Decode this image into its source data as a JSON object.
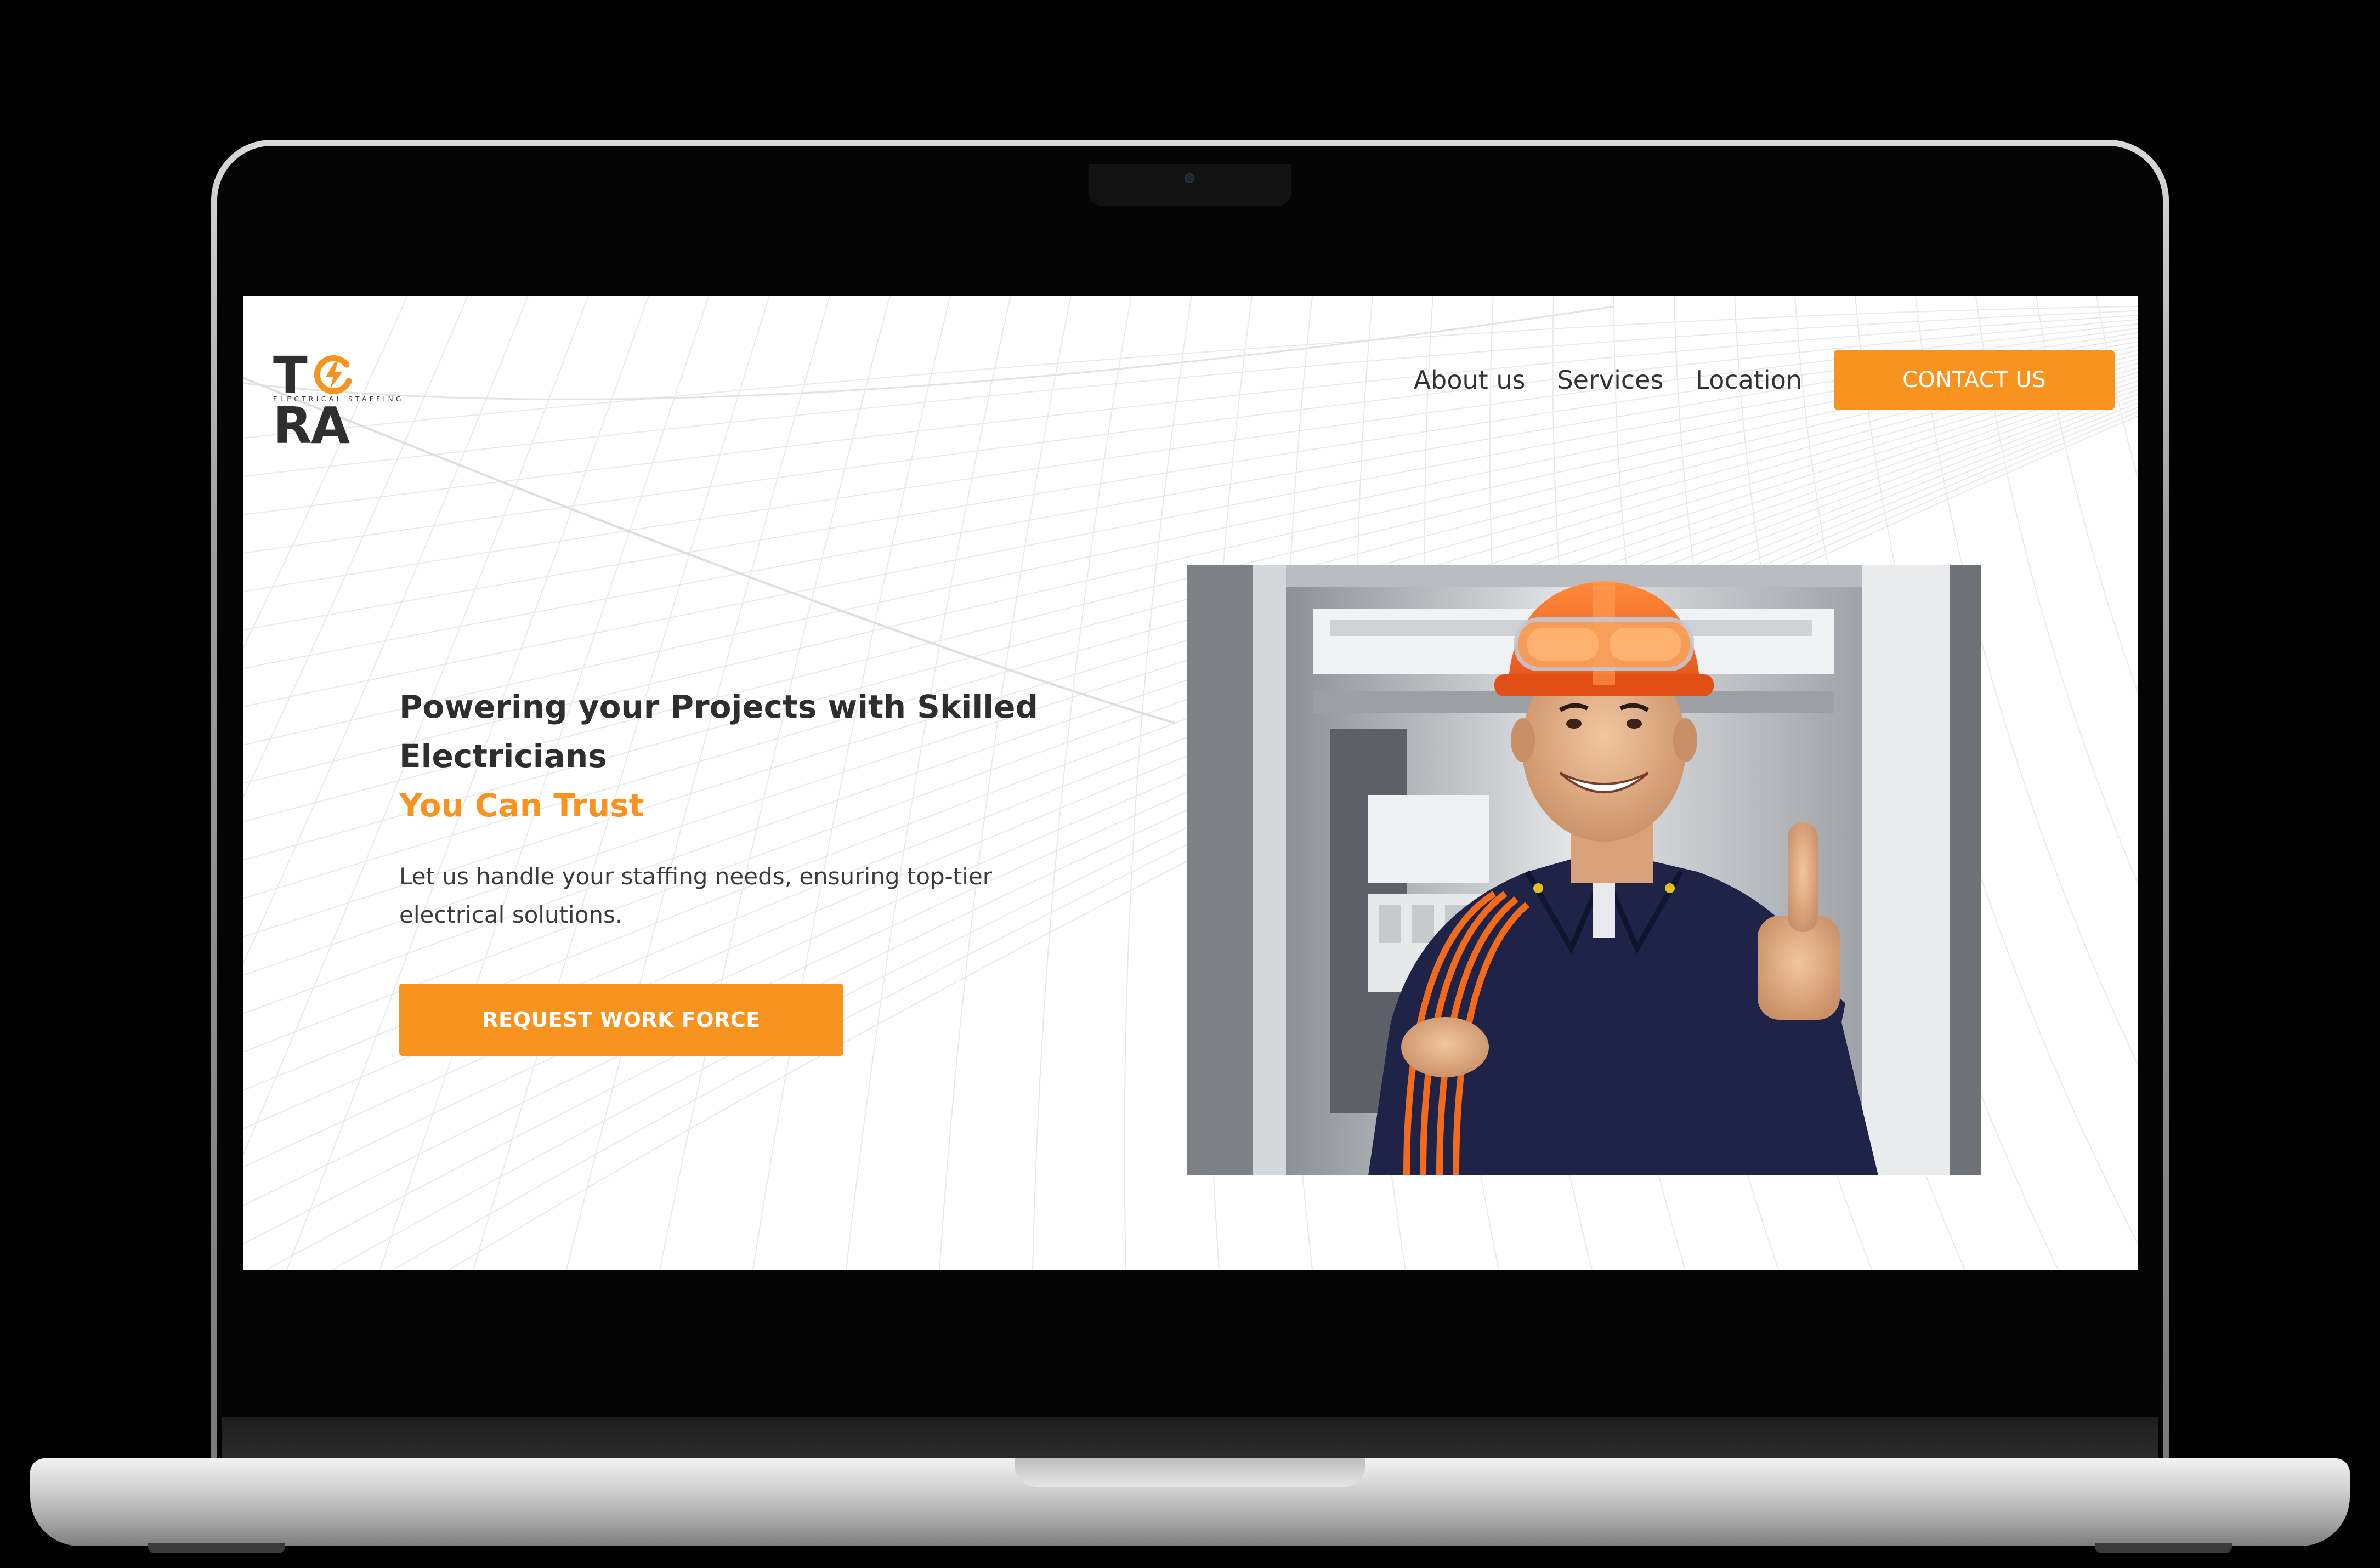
{
  "logo": {
    "brand": "TERA",
    "brand_left": "T",
    "brand_right": "RA",
    "tagline": "ELECTRICAL STAFFING"
  },
  "nav": {
    "links": [
      "About us",
      "Services",
      "Location"
    ],
    "contact_label": "CONTACT US"
  },
  "hero": {
    "title_line1": "Powering your Projects with Skilled",
    "title_line2": "Electricians",
    "title_accent": "You Can Trust",
    "description_line1": "Let us handle your staffing needs, ensuring top-tier",
    "description_line2": "electrical solutions.",
    "cta_label": "REQUEST WORK FORCE"
  },
  "colors": {
    "accent": "#f7931e",
    "text_dark": "#2e2e2e",
    "background": "#ffffff"
  },
  "icons": {
    "logo_mark": "lightning-bolt-icon",
    "hero_image": "electrician-thumbs-up-photo"
  }
}
